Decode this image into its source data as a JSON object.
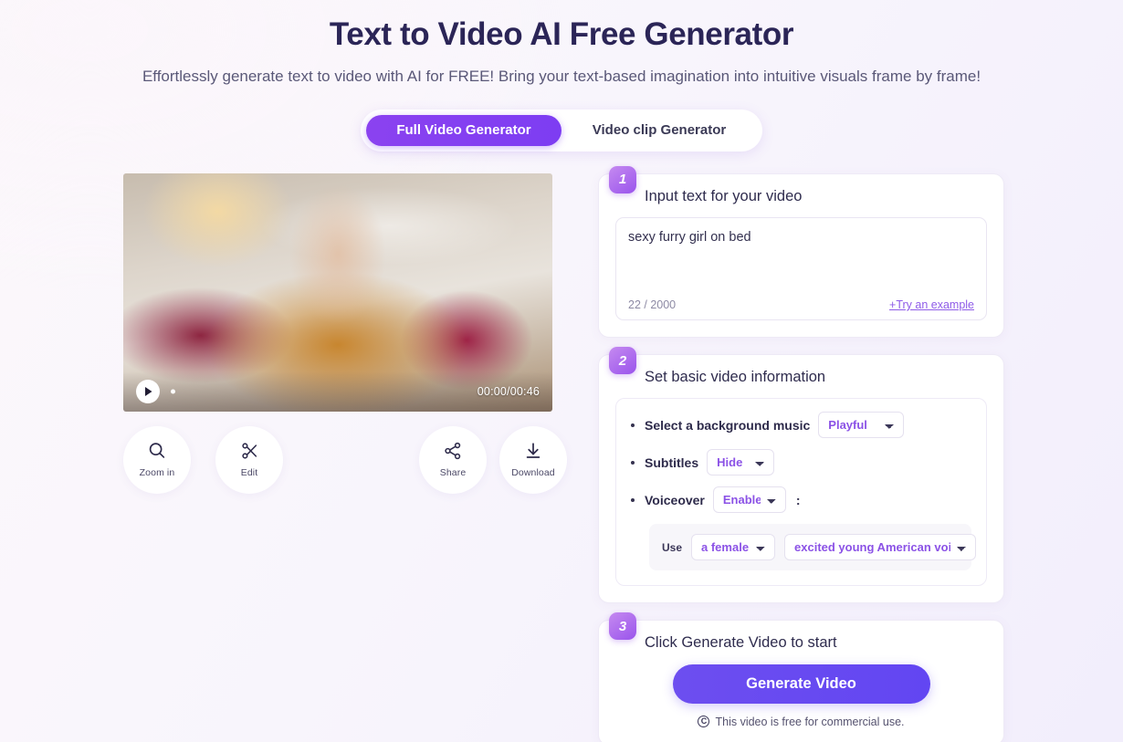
{
  "header": {
    "title": "Text to Video AI Free Generator",
    "subtitle": "Effortlessly generate text to video with AI for FREE! Bring your text-based imagination into intuitive visuals frame by frame!"
  },
  "tabs": [
    {
      "label": "Full Video Generator",
      "active": true
    },
    {
      "label": "Video clip Generator",
      "active": false
    }
  ],
  "player": {
    "time": "00:00/00:46",
    "play_icon": "play-icon"
  },
  "actions": [
    {
      "label": "Zoom in",
      "icon": "magnifier-icon"
    },
    {
      "label": "Edit",
      "icon": "scissors-icon"
    },
    {
      "label": "Share",
      "icon": "share-nodes-icon"
    },
    {
      "label": "Download",
      "icon": "download-arrow-icon"
    }
  ],
  "steps": {
    "one": {
      "badge": "1",
      "title": "Input text for your video",
      "prompt_value": "sexy furry girl on bed",
      "prompt_placeholder": "Input text for your video",
      "char_count": "22 / 2000",
      "try_example": "+Try an example"
    },
    "two": {
      "badge": "2",
      "title": "Set basic video information",
      "music_label": "Select a background music",
      "music_value": "Playful",
      "music_options": [
        "Playful"
      ],
      "subtitles_label": "Subtitles",
      "subtitles_value": "Hide",
      "subtitles_options": [
        "Hide"
      ],
      "voiceover_label": "Voiceover",
      "voiceover_value": "Enable",
      "voiceover_options": [
        "Enable"
      ],
      "voiceover_colon": ":",
      "use_label": "Use",
      "gender_value": "a female",
      "gender_options": [
        "a female"
      ],
      "style_value": "excited young American voice",
      "style_options": [
        "excited young American voice"
      ]
    },
    "three": {
      "badge": "3",
      "title": "Click Generate Video to start",
      "generate_label": "Generate Video",
      "free_note": "This video is free for commercial use.",
      "copyright_glyph": "C"
    }
  },
  "colors": {
    "accent_purple": "#7d3df2",
    "badge_purple": "#9a54ec",
    "generate_blue_purple": "#6246f2",
    "select_text": "#8b52e6",
    "title_navy": "#2b2557",
    "page_bg": "#f8f5fc"
  }
}
